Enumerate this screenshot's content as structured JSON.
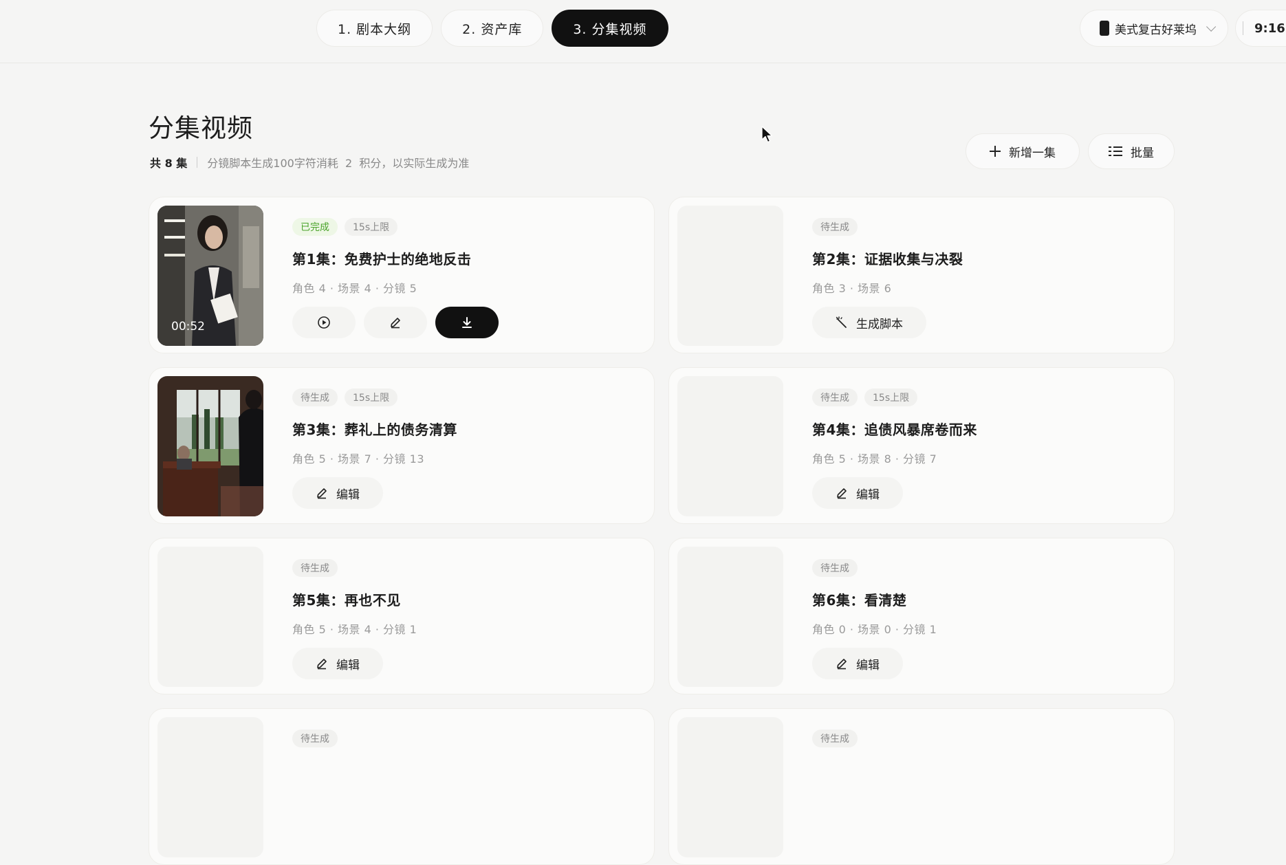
{
  "tabs": [
    {
      "label": "1. 剧本大纲",
      "active": false
    },
    {
      "label": "2. 资产库",
      "active": false
    },
    {
      "label": "3. 分集视频",
      "active": true
    }
  ],
  "style_select": {
    "label": "美式复古好莱坞",
    "icon": "phone-portrait-icon"
  },
  "ratio_select": {
    "label": "9:16"
  },
  "page": {
    "title": "分集视频",
    "count": "共 8 集",
    "note": "分镜脚本生成100字符消耗  2  积分，以实际生成为准"
  },
  "buttons": {
    "add": "新增一集",
    "batch": "批量"
  },
  "episodes": [
    {
      "status": "已完成",
      "limit": "15s上限",
      "title": "第1集：免费护士的绝地反击",
      "meta": "角色 4 · 场景 4 · 分镜 5",
      "duration": "00:52",
      "action": "video"
    },
    {
      "status": "待生成",
      "title": "第2集：证据收集与决裂",
      "meta": "角色 3 · 场景 6",
      "action": "generate",
      "action_label": "生成脚本"
    },
    {
      "status": "待生成",
      "limit": "15s上限",
      "title": "第3集：葬礼上的债务清算",
      "meta": "角色 5 · 场景 7 · 分镜 13",
      "action": "edit",
      "action_label": "编辑"
    },
    {
      "status": "待生成",
      "limit": "15s上限",
      "title": "第4集：追债风暴席卷而来",
      "meta": "角色 5 · 场景 8 · 分镜 7",
      "action": "edit",
      "action_label": "编辑"
    },
    {
      "status": "待生成",
      "title": "第5集：再也不见",
      "meta": "角色 5 · 场景 4 · 分镜 1",
      "action": "edit",
      "action_label": "编辑"
    },
    {
      "status": "待生成",
      "title": "第6集：看清楚",
      "meta": "角色 0 · 场景 0 · 分镜 1",
      "action": "edit",
      "action_label": "编辑"
    },
    {
      "status": "待生成"
    },
    {
      "status": "待生成"
    }
  ],
  "colors": {
    "accent_dark": "#111111",
    "done_green": "#4aa32a",
    "background": "#f5f5f4"
  }
}
